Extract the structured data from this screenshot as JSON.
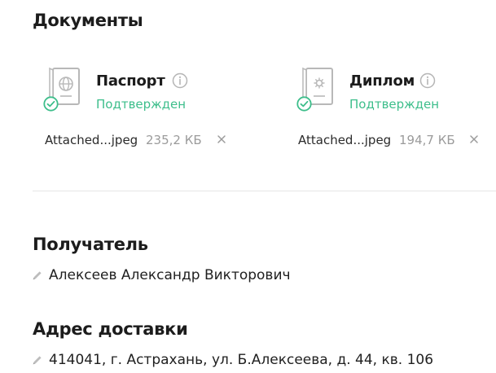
{
  "documents_section": {
    "title": "Документы",
    "items": [
      {
        "icon": "passport-icon",
        "title": "Паспорт",
        "status": "Подтвержден",
        "file": {
          "name": "Attached...jpeg",
          "size": "235,2 КБ"
        }
      },
      {
        "icon": "diploma-icon",
        "title": "Диплом",
        "status": "Подтвержден",
        "file": {
          "name": "Attached...jpeg",
          "size": "194,7 КБ"
        }
      }
    ]
  },
  "recipient_section": {
    "title": "Получатель",
    "value": "Алексеев Александр Викторович"
  },
  "address_section": {
    "title": "Адрес доставки",
    "value": "414041, г. Астрахань, ул. Б.Алексеева, д. 44, кв. 106"
  },
  "colors": {
    "status_green": "#3dbe8b",
    "muted_text": "#9b9b9b",
    "icon_gray": "#b5b5b5"
  }
}
